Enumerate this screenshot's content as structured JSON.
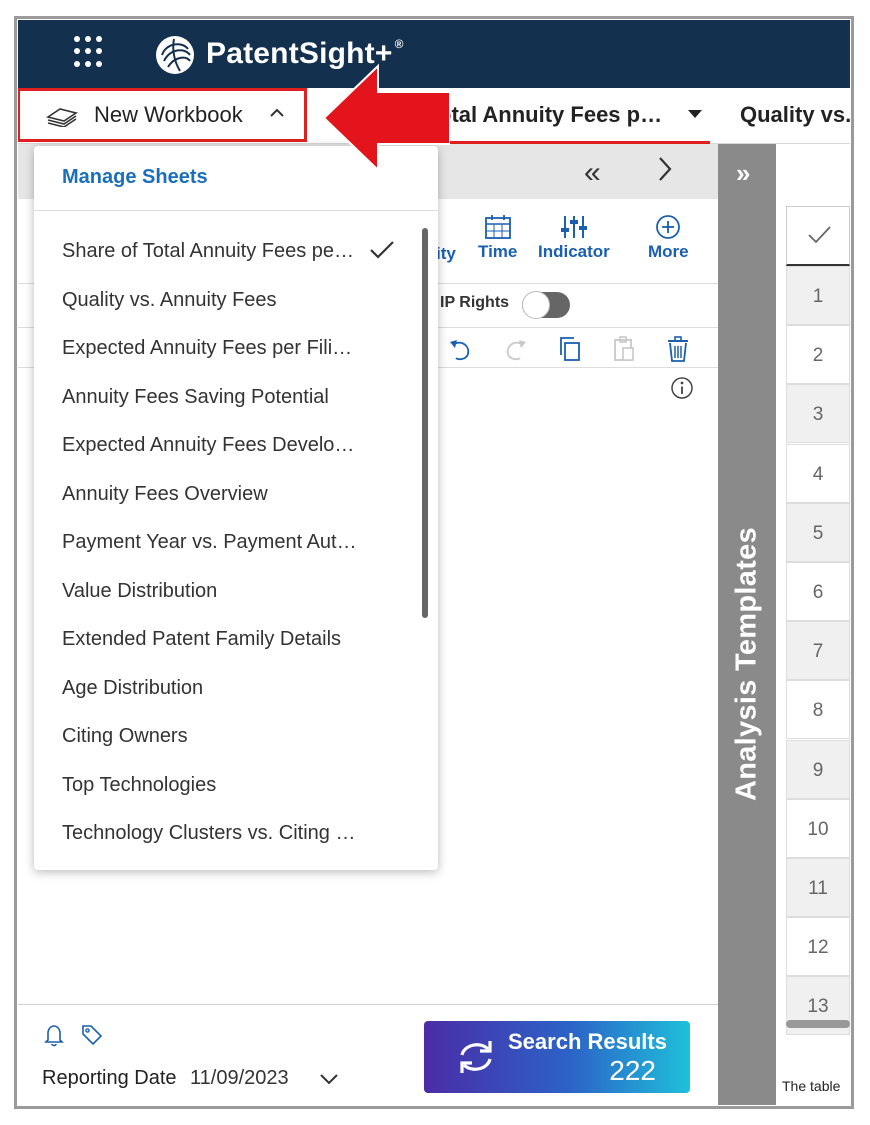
{
  "app": {
    "brand": "PatentSight+"
  },
  "tabs": {
    "workbook_label": "New Workbook",
    "active_tab": "otal Annuity Fees p…",
    "second_tab": "Quality vs."
  },
  "dropdown": {
    "manage_label": "Manage Sheets",
    "items": [
      {
        "label": "Share of Total Annuity Fees pe…",
        "selected": true
      },
      {
        "label": "Quality vs. Annuity Fees"
      },
      {
        "label": "Expected Annuity Fees per Fili…"
      },
      {
        "label": "Annuity Fees Saving Potential"
      },
      {
        "label": "Expected Annuity Fees Develo…"
      },
      {
        "label": "Annuity Fees Overview"
      },
      {
        "label": "Payment Year vs. Payment Aut…"
      },
      {
        "label": "Value Distribution"
      },
      {
        "label": "Extended Patent Family Details"
      },
      {
        "label": "Age Distribution"
      },
      {
        "label": "Citing Owners"
      },
      {
        "label": "Top Technologies"
      },
      {
        "label": "Technology Clusters vs. Citing …"
      }
    ]
  },
  "toolbar": {
    "partial_label": "ity",
    "time_label": "Time",
    "indicator_label": "Indicator",
    "more_label": "More",
    "ip_rights_label": "IP Rights"
  },
  "sidebar": {
    "label": "Analysis Templates"
  },
  "grid": {
    "rows": [
      "1",
      "2",
      "3",
      "4",
      "5",
      "6",
      "7",
      "8",
      "9",
      "10",
      "11",
      "12",
      "13"
    ],
    "footer_text": "The table"
  },
  "footer": {
    "reporting_label": "Reporting Date",
    "reporting_date": "11/09/2023",
    "search_label": "Search Results",
    "search_count": "222"
  },
  "colors": {
    "topbar": "#13304f",
    "highlight": "#e02020",
    "link_blue": "#1a6fbd",
    "sidebar_gray": "#8a8a8a"
  }
}
